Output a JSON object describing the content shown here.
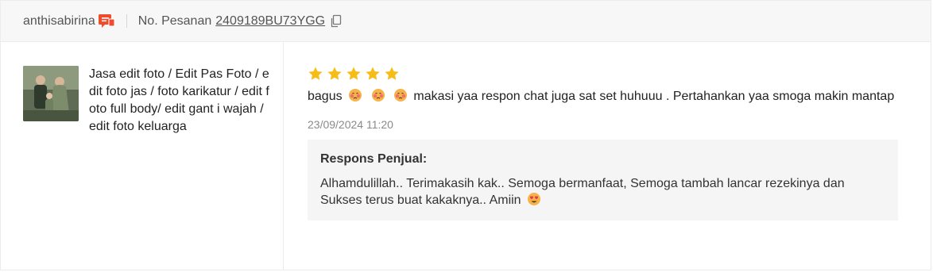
{
  "header": {
    "username": "anthisabirina",
    "order_label": "No. Pesanan",
    "order_id": "2409189BU73YGG"
  },
  "product": {
    "name": "Jasa edit foto / Edit Pas Foto / edit foto jas / foto karikatur / edit foto full body/ edit gant i wajah / edit foto keluarga"
  },
  "review": {
    "rating": 5,
    "comment_start": "bagus",
    "comment_end": "makasi yaa respon chat juga sat set huhuuu . Pertahankan yaa smoga makin mantap",
    "timestamp": "23/09/2024 11:20"
  },
  "seller_response": {
    "label": "Respons Penjual:",
    "text": "Alhamdulillah.. Terimakasih kak.. Semoga bermanfaat, Semoga tambah lancar rezekinya dan Sukses terus buat kakaknya.. Amiin"
  },
  "colors": {
    "star": "#f6bd16",
    "brand": "#ee4d2d"
  }
}
